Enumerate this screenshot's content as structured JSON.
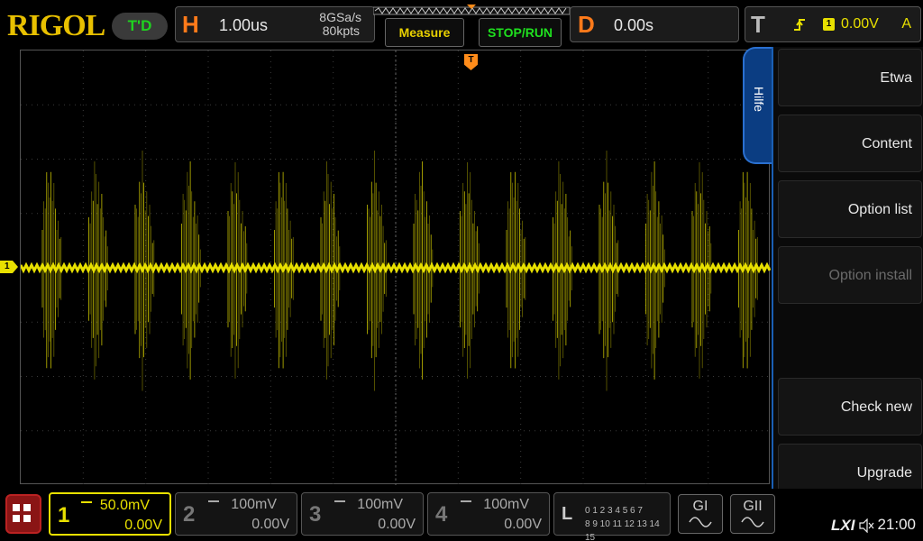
{
  "brand": {
    "logo": "RIGOL",
    "run_state": "T'D"
  },
  "horizontal": {
    "letter": "H",
    "timebase": "1.00us",
    "sample_rate": "8GSa/s",
    "memory_depth": "80kpts"
  },
  "buttons": {
    "measure": "Measure",
    "stop_run": "STOP/RUN"
  },
  "delay": {
    "letter": "D",
    "value": "0.00s"
  },
  "trigger": {
    "letter": "T",
    "source": "1",
    "level": "0.00V",
    "mode": "A"
  },
  "menu": {
    "tab": "Hilfe",
    "items": [
      {
        "label": "Etwa",
        "enabled": true
      },
      {
        "label": "Content",
        "enabled": true
      },
      {
        "label": "Option list",
        "enabled": true
      },
      {
        "label": "Option install",
        "enabled": false
      },
      {
        "label": "Check new",
        "enabled": true
      },
      {
        "label": "Upgrade",
        "enabled": true
      }
    ]
  },
  "markers": {
    "channel1": "1",
    "trigger": "T"
  },
  "channels": [
    {
      "num": "1",
      "scale": "50.0mV",
      "offset": "0.00V",
      "active": true
    },
    {
      "num": "2",
      "scale": "100mV",
      "offset": "0.00V",
      "active": false
    },
    {
      "num": "3",
      "scale": "100mV",
      "offset": "0.00V",
      "active": false
    },
    {
      "num": "4",
      "scale": "100mV",
      "offset": "0.00V",
      "active": false
    }
  ],
  "logic": {
    "letter": "L",
    "row1": "0 1 2 3   4 5 6 7",
    "row2": "8 9 10 11 12 13 14 15"
  },
  "generators": {
    "g1": "GI",
    "g2": "GII"
  },
  "status": {
    "lxi": "LXI",
    "time": "21:00"
  },
  "colors": {
    "ch1": "#e8e000",
    "accent": "#ff7a1a",
    "menu_border": "#1a5fb4"
  }
}
